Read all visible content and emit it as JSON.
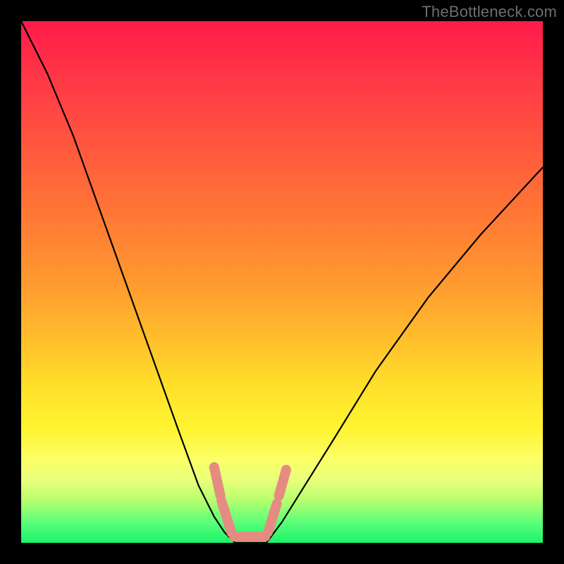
{
  "watermark": "TheBottleneck.com",
  "chart_data": {
    "type": "line",
    "title": "",
    "xlabel": "",
    "ylabel": "",
    "xlim": [
      0,
      100
    ],
    "ylim": [
      0,
      100
    ],
    "grid": false,
    "background_gradient": {
      "direction": "vertical",
      "stops": [
        {
          "pos": 0,
          "color": "#ff1a4a"
        },
        {
          "pos": 50,
          "color": "#ff9930"
        },
        {
          "pos": 78,
          "color": "#fff430"
        },
        {
          "pos": 100,
          "color": "#1cf26a"
        }
      ]
    },
    "series": [
      {
        "name": "left-branch",
        "x": [
          0,
          5,
          10,
          15,
          20,
          25,
          30,
          34,
          37,
          39,
          41
        ],
        "y": [
          100,
          90,
          78,
          64,
          50,
          36,
          22,
          11,
          5,
          2,
          0
        ]
      },
      {
        "name": "trough",
        "x": [
          41,
          43,
          45,
          47
        ],
        "y": [
          0,
          0,
          0,
          0
        ]
      },
      {
        "name": "right-branch",
        "x": [
          47,
          50,
          55,
          60,
          68,
          78,
          88,
          100
        ],
        "y": [
          0,
          4,
          12,
          20,
          33,
          47,
          59,
          72
        ]
      }
    ],
    "annotations": [
      {
        "name": "salmon-marker",
        "shape": "u-segments",
        "color": "#e58b82",
        "segments": [
          {
            "x": [
              37.0,
              38.2
            ],
            "y": [
              14.5,
              9.0
            ]
          },
          {
            "x": [
              38.4,
              40.3
            ],
            "y": [
              8.0,
              2.0
            ]
          },
          {
            "x": [
              40.8,
              46.8
            ],
            "y": [
              1.2,
              1.2
            ]
          },
          {
            "x": [
              47.3,
              49.0
            ],
            "y": [
              2.0,
              7.5
            ]
          },
          {
            "x": [
              49.4,
              50.8
            ],
            "y": [
              9.0,
              14.0
            ]
          }
        ]
      }
    ]
  }
}
